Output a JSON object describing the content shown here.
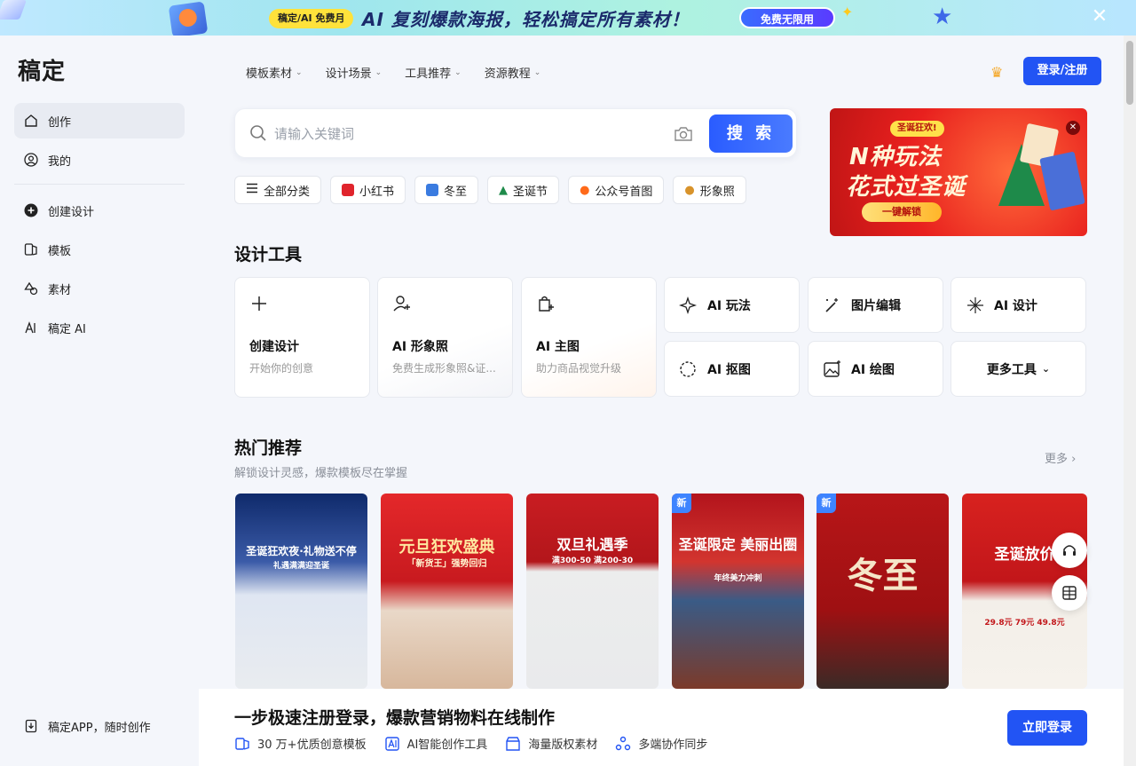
{
  "banner": {
    "pill": "稿定/AI 免费月",
    "headline": "AI 复刻爆款海报，轻松搞定所有素材！",
    "cta": "免费无限用",
    "close_icon": "close-icon"
  },
  "sidebar": {
    "logo": "稿定",
    "items": [
      {
        "label": "创作",
        "icon": "home-icon"
      },
      {
        "label": "我的",
        "icon": "user-icon"
      },
      {
        "label": "创建设计",
        "icon": "plus-circle-icon"
      },
      {
        "label": "模板",
        "icon": "template-icon"
      },
      {
        "label": "素材",
        "icon": "shapes-icon"
      },
      {
        "label": "稿定 AI",
        "icon": "ai-icon"
      }
    ],
    "app_link": "稿定APP，随时创作"
  },
  "topnav": {
    "items": [
      "模板素材",
      "设计场景",
      "工具推荐",
      "资源教程"
    ],
    "login": "登录/注册"
  },
  "search": {
    "placeholder": "请输入关键词",
    "button": "搜 索"
  },
  "chips": [
    "全部分类",
    "小红书",
    "冬至",
    "圣诞节",
    "公众号首图",
    "形象照"
  ],
  "promo": {
    "tag": "圣诞狂欢!",
    "title_line1": "N种玩法",
    "title_line2": "花式过圣诞",
    "button": "一键解锁"
  },
  "tools": {
    "title": "设计工具",
    "big": [
      {
        "title": "创建设计",
        "sub": "开始你的创意",
        "icon": "plus-icon"
      },
      {
        "title": "AI 形象照",
        "sub": "免费生成形象照&证...",
        "icon": "person-plus-icon"
      },
      {
        "title": "AI 主图",
        "sub": "助力商品视觉升级",
        "icon": "bag-icon"
      }
    ],
    "small": [
      {
        "label": "AI 玩法",
        "icon": "sparkle-star-icon"
      },
      {
        "label": "图片编辑",
        "icon": "magic-wand-icon"
      },
      {
        "label": "AI 设计",
        "icon": "sparkle-icon"
      },
      {
        "label": "AI 抠图",
        "icon": "cutout-icon"
      },
      {
        "label": "AI 绘图",
        "icon": "image-sparkle-icon"
      },
      {
        "label": "更多工具",
        "icon": "chevron-down-icon"
      }
    ]
  },
  "hot": {
    "title": "热门推荐",
    "subtitle": "解锁设计灵感，爆款模板尽在掌握",
    "more": "更多",
    "templates": [
      {
        "headline": "圣诞狂欢夜·礼物送不停",
        "sub": "礼遇满满迎圣诞",
        "new": ""
      },
      {
        "headline": "元旦狂欢盛典",
        "sub": "「新货王」强势回归",
        "new": ""
      },
      {
        "headline": "双旦礼遇季",
        "sub": "满300-50 满200-30",
        "new": ""
      },
      {
        "headline": "圣诞限定 美丽出圈",
        "sub": "年终美力冲刺",
        "new": "新"
      },
      {
        "headline": "冬至",
        "sub": "",
        "new": "新"
      },
      {
        "headline": "圣诞放价",
        "sub": "29.8元 79元 49.8元",
        "new": ""
      }
    ]
  },
  "bottom": {
    "title": "一步极速注册登录，爆款营销物料在线制作",
    "features": [
      "30 万+优质创意模板",
      "AI智能创作工具",
      "海量版权素材",
      "多端协作同步"
    ],
    "login": "立即登录"
  },
  "colors": {
    "accent": "#2254f4",
    "promo_red": "#e8201e"
  }
}
